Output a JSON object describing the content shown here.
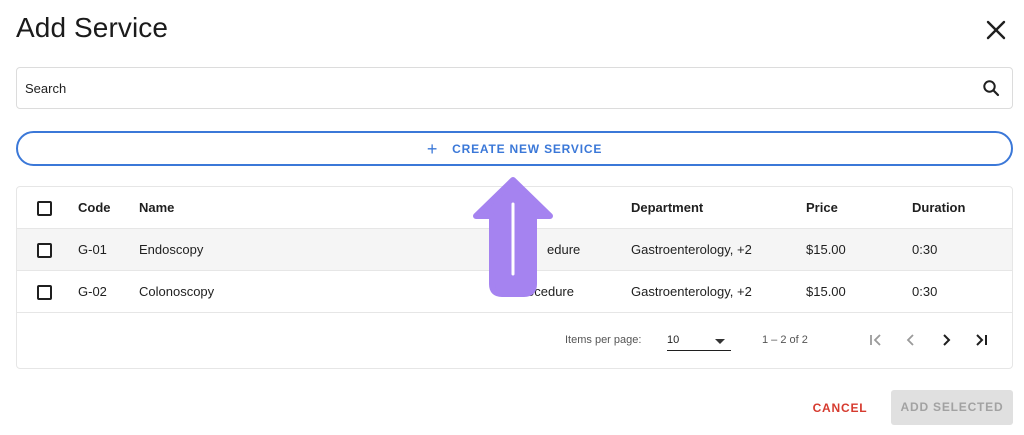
{
  "dialog": {
    "title": "Add Service",
    "close_icon": "close-icon"
  },
  "search": {
    "placeholder": "Search",
    "value": "",
    "icon": "search-icon"
  },
  "create_button": {
    "icon": "plus-icon",
    "plus": "+",
    "label": "CREATE NEW SERVICE",
    "color": "#3b78d8"
  },
  "table": {
    "columns": [
      "Code",
      "Name",
      "",
      "Department",
      "Price",
      "Duration"
    ],
    "header_type_fragment": "",
    "rows": [
      {
        "code": "G-01",
        "name": "Endoscopy",
        "type": "Procedure",
        "type_visible": "edure",
        "department": "Gastroenterology, +2",
        "price": "$15.00",
        "duration": "0:30"
      },
      {
        "code": "G-02",
        "name": "Colonoscopy",
        "type": "Procedure",
        "type_visible": "ocedure",
        "department": "Gastroenterology, +2",
        "price": "$15.00",
        "duration": "0:30"
      }
    ]
  },
  "paginator": {
    "items_per_page_label": "Items per page:",
    "page_size": "10",
    "range": "1 – 2 of 2",
    "icons": [
      "first-page-icon",
      "prev-page-icon",
      "next-page-icon",
      "last-page-icon"
    ]
  },
  "actions": {
    "cancel_label": "CANCEL",
    "add_selected_label": "ADD SELECTED",
    "cancel_color": "#d63b2f"
  },
  "overlay": {
    "arrow_color": "#a583f0",
    "arrow_icon": "up-arrow-annotation"
  }
}
